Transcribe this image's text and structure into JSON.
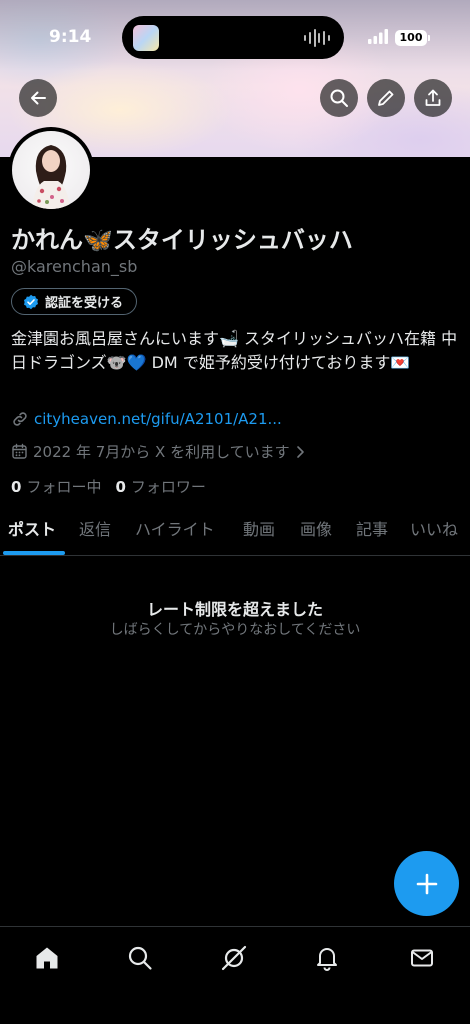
{
  "status_bar": {
    "time": "9:14",
    "battery": "100"
  },
  "header": {
    "back_icon": "arrow-left-icon",
    "search_icon": "search-icon",
    "edit_icon": "pencil-icon",
    "share_icon": "share-icon"
  },
  "profile": {
    "display_name": "かれん🦋スタイリッシュバッハ",
    "handle": "@karenchan_sb",
    "verify_button": "認証を受ける",
    "bio": "金津園お風呂屋さんにいます🛁 スタイリッシュバッハ在籍 中日ドラゴンズ🐨💙 DM で姫予約受け付けております💌",
    "website": "cityheaven.net/gifu/A2101/A21...",
    "joined": "2022 年 7月から X を利用しています",
    "following_count": "0",
    "following_label": "フォロー中",
    "followers_count": "0",
    "followers_label": "フォロワー"
  },
  "tabs": [
    "ポスト",
    "返信",
    "ハイライト",
    "動画",
    "画像",
    "記事",
    "いいね"
  ],
  "active_tab": "ポスト",
  "empty_state": {
    "title": "レート制限を超えました",
    "subtitle": "しばらくしてからやりなおしてください"
  },
  "fab_icon": "plus-icon",
  "bottom_nav": [
    "home-icon",
    "search-icon",
    "grok-icon",
    "bell-icon",
    "mail-icon"
  ],
  "colors": {
    "accent": "#1d9bf0",
    "background": "#000000",
    "secondary_text": "#71767b"
  }
}
